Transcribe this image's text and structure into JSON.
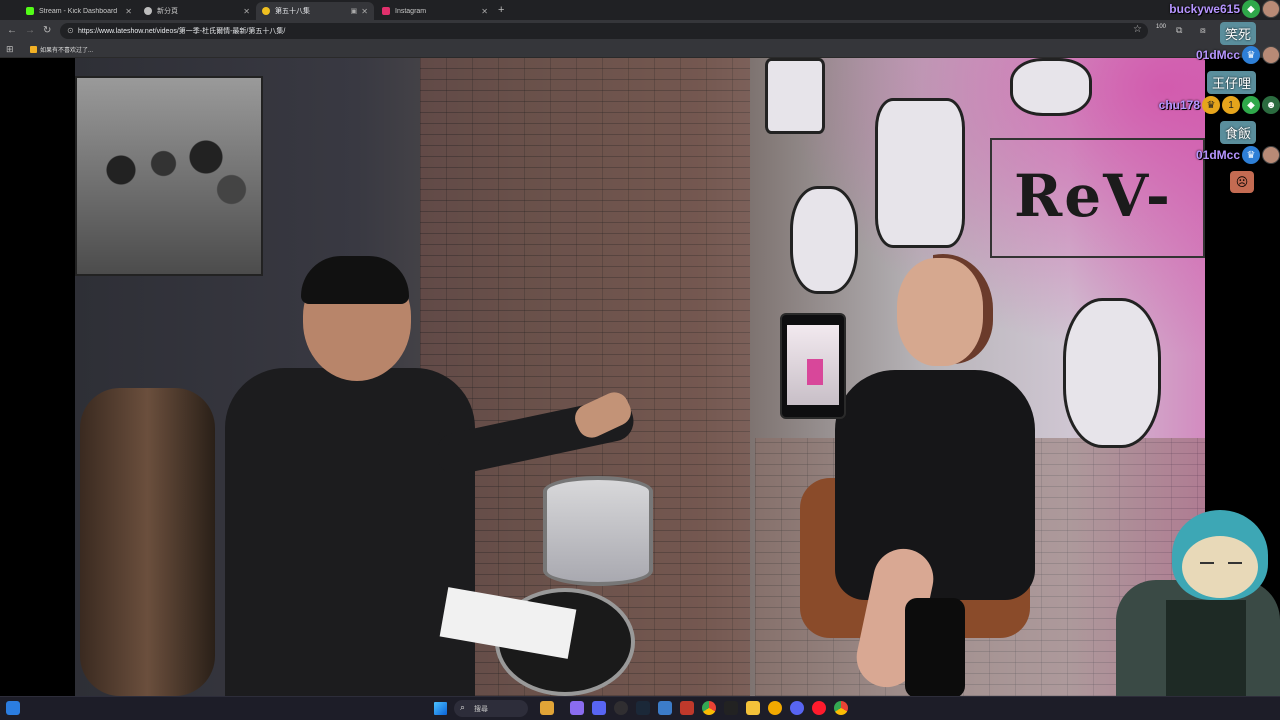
{
  "browser": {
    "tabs": [
      {
        "title": "Stream - Kick Dashboard",
        "favicon_color": "#53fc18",
        "active": false
      },
      {
        "title": "新分頁",
        "favicon_color": "#bdbdbd",
        "active": false
      },
      {
        "title": "第五十八集",
        "favicon_color": "#f0c020",
        "active": true
      },
      {
        "title": "Instagram",
        "favicon_color": "#e1306c",
        "active": false
      }
    ],
    "new_tab_symbol": "+",
    "url": "https://www.lateshow.net/videos/第一季-杜氏爾情-最新/第五十八集/",
    "extension_badge": "100",
    "bookmark": "如果有不喜欢过了..."
  },
  "chat": {
    "lines": [
      {
        "name": "buckywe615",
        "badges": [
          "green",
          "avatar"
        ]
      },
      {
        "message": "笑死"
      },
      {
        "name": "01dMcc",
        "badges": [
          "blue",
          "avatar"
        ]
      },
      {
        "message": "王仔哩"
      },
      {
        "name": "chu178",
        "badges": [
          "crown",
          "one",
          "green",
          "dark"
        ]
      },
      {
        "message": "食飯"
      },
      {
        "name": "01dMcc",
        "badges": [
          "blue",
          "avatar"
        ]
      },
      {
        "emote": "emote-face"
      }
    ]
  },
  "video": {
    "sign_text": "ReV-"
  },
  "taskbar": {
    "search_label": "搜尋"
  }
}
